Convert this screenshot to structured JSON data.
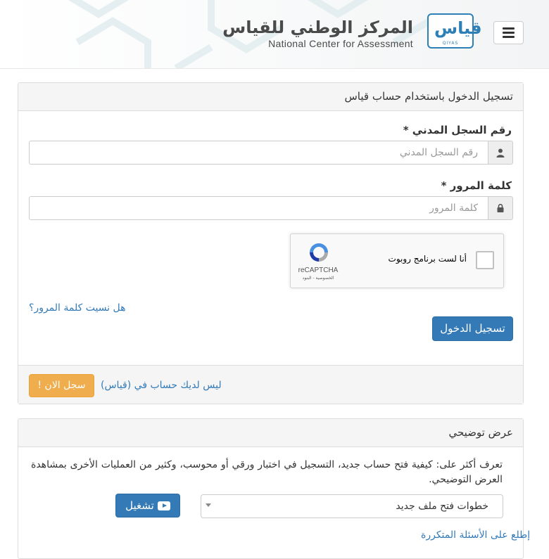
{
  "header": {
    "brand_ar": "المركز الوطني للقياس",
    "brand_en": "National Center for Assessment",
    "logo_glyph": "قياس",
    "logo_sub": "QIYAS",
    "menu_icon": "hamburger-menu-icon"
  },
  "login": {
    "title": "تسجيل الدخول باستخدام حساب قياس",
    "id_label": "رقم السجل المدني *",
    "id_placeholder": "رقم السجل المدني",
    "id_icon": "user-icon",
    "password_label": "كلمة المرور *",
    "password_placeholder": "كلمة المرور",
    "password_icon": "lock-icon",
    "recaptcha": {
      "checkbox_label": "أنا لست برنامج روبوت",
      "brand": "reCAPTCHA",
      "links": "الخصوصية - البنود"
    },
    "forgot_link": "هل نسيت كلمة المرور؟",
    "submit_label": "تسجيل الدخول",
    "no_account_text": "ليس لديك حساب في (قياس)",
    "register_label": "سجل الان !"
  },
  "demo": {
    "title": "عرض توضيحي",
    "description": "تعرف أكثر على: كيفية فتح حساب جديد، التسجيل في اختبار ورقي أو محوسب، وكثير من العمليات الأخرى بمشاهدة العرض التوضيحي.",
    "select_value": "خطوات فتح ملف جديد",
    "play_label": "تشغيل",
    "play_icon": "youtube-play-icon",
    "faq_link": "إطلع على الأسئلة المتكررة"
  },
  "colors": {
    "primary": "#337ab7",
    "warning": "#f0ad4e",
    "brand": "#2f7fb7"
  }
}
